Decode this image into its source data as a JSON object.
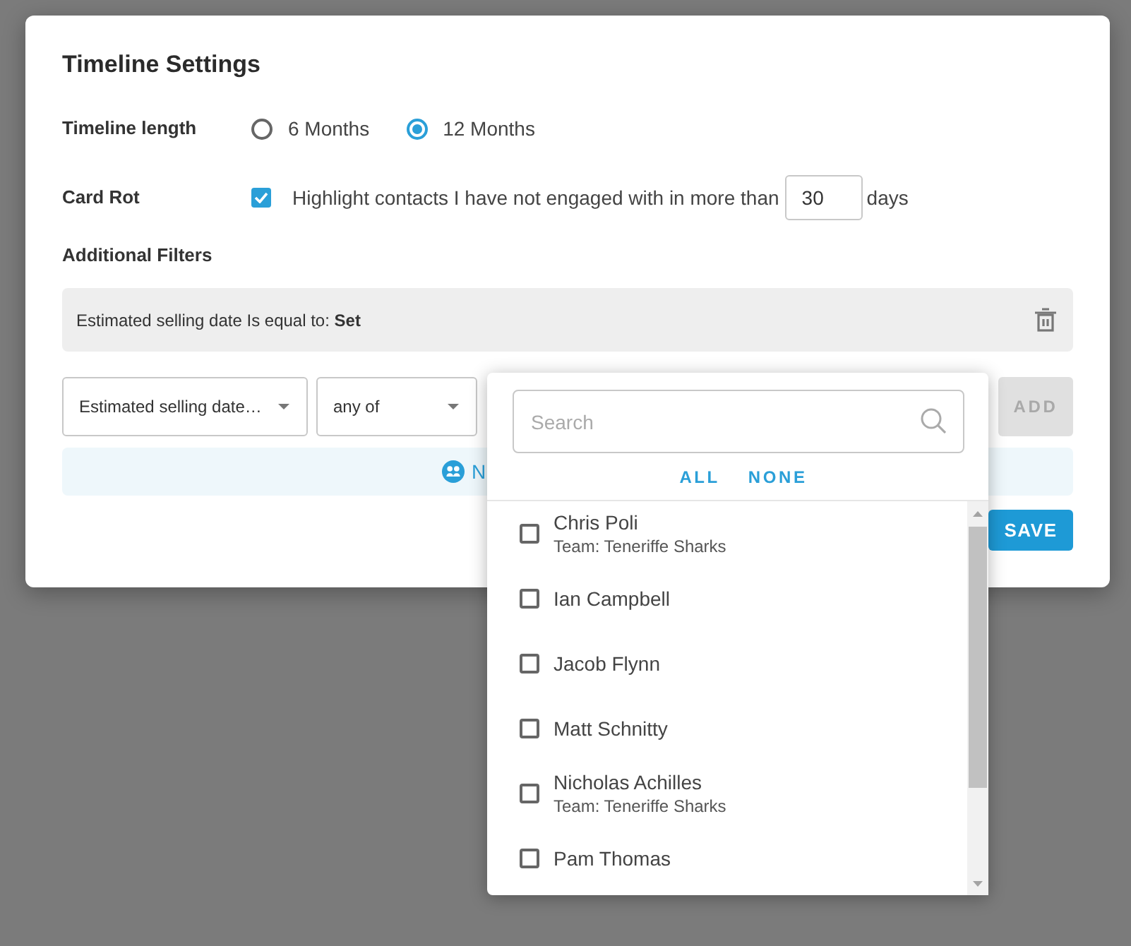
{
  "dialog": {
    "title": "Timeline Settings"
  },
  "timeline_length": {
    "label": "Timeline length",
    "options": [
      {
        "label": "6 Months",
        "selected": false
      },
      {
        "label": "12 Months",
        "selected": true
      }
    ]
  },
  "card_rot": {
    "label": "Card Rot",
    "checked": true,
    "text": "Highlight contacts I have not engaged with in more than",
    "days": "30",
    "unit": "days"
  },
  "additional_filters": {
    "label": "Additional Filters",
    "filters": [
      {
        "text": "Estimated selling date Is equal to: **Set**"
      }
    ],
    "field_select": {
      "value": "Estimated selling date…"
    },
    "operator_select": {
      "value": "any of"
    },
    "add_button": {
      "label": "ADD",
      "disabled": true
    },
    "banner": {
      "text": "N"
    }
  },
  "save_button": {
    "label": "SAVE"
  },
  "dropdown": {
    "search": {
      "placeholder": "Search"
    },
    "actions": [
      "ALL",
      "NONE"
    ],
    "options": [
      {
        "name": "Chris Poli",
        "team": "Team: Teneriffe Sharks",
        "checked": false
      },
      {
        "name": "Ian Campbell",
        "checked": false
      },
      {
        "name": "Jacob Flynn",
        "checked": false
      },
      {
        "name": "Matt Schnitty",
        "checked": false
      },
      {
        "name": "Nicholas Achilles",
        "team": "Team: Teneriffe Sharks",
        "checked": false
      },
      {
        "name": "Pam Thomas",
        "checked": false
      }
    ]
  }
}
